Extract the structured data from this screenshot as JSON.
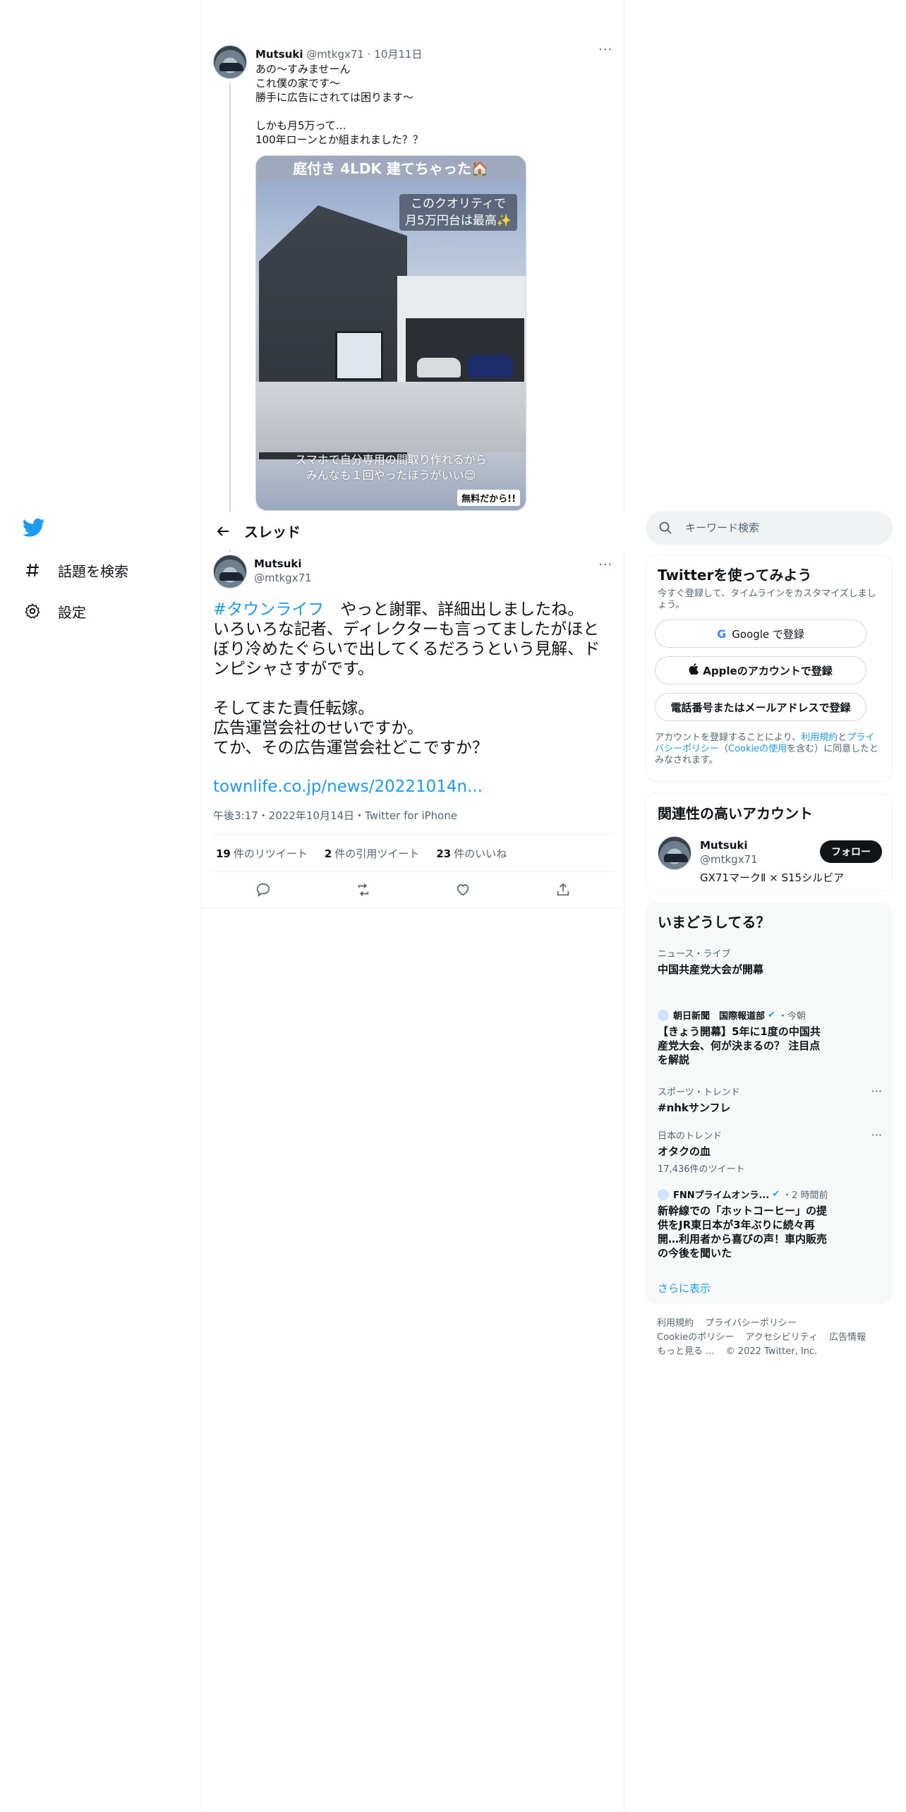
{
  "leftnav": {
    "explore_label": "話題を検索",
    "settings_label": "設定"
  },
  "parent_tweet": {
    "name": "Mutsuki",
    "handle": "@mtkgx71",
    "date": "10月11日",
    "text": "あの〜すみませーん\nこれ僕の家です〜\n勝手に広告にされては困ります〜\n\nしかも月5万って…\n100年ローンとか組まれました？？",
    "media": {
      "banner": "庭付き 4LDK 建てちゃった🏠",
      "caption_top": "このクオリティで\n月5万円台は最高✨",
      "caption_bottom": "スマホで自分専用の間取り作れるから\nみんなも１回やったほうがいい😌",
      "badge": "無料だから!!"
    }
  },
  "thread_header": {
    "title": "スレッド"
  },
  "focus_tweet": {
    "name": "Mutsuki",
    "handle": "@mtkgx71",
    "hashtag": "#タウンライフ",
    "text": "　やっと謝罪、詳細出しましたね。\nいろいろな記者、ディレクターも言ってましたがほとぼり冷めたぐらいで出してくるだろうという見解、ドンピシャさすがです。\n\nそしてまた責任転嫁。\n広告運営会社のせいですか。\nてか、その広告運営会社どこですか？",
    "link": "townlife.co.jp/news/20221014n...",
    "meta": "午後3:17・2022年10月14日・Twitter for iPhone",
    "retweets": {
      "count": "19",
      "label": "件のリツイート"
    },
    "quotes": {
      "count": "2",
      "label": "件の引用ツイート"
    },
    "likes": {
      "count": "23",
      "label": "件のいいね"
    }
  },
  "search": {
    "placeholder": "キーワード検索"
  },
  "signup": {
    "title": "Twitterを使ってみよう",
    "subtitle": "今すぐ登録して、タイムラインをカスタマイズしましょう。",
    "google_label": "Google で登録",
    "apple_label": "Appleのアカウントで登録",
    "phone_label": "電話番号またはメールアドレスで登録",
    "legal_prefix": "アカウントを登録することにより、",
    "legal_link1": "利用規約",
    "legal_and": "と",
    "legal_link2": "プライバシーポリシー",
    "legal_mid": "（",
    "legal_link3": "Cookieの使用",
    "legal_suffix": "を含む）に同意したとみなされます。"
  },
  "related": {
    "title": "関連性の高いアカウント",
    "name": "Mutsuki",
    "handle": "@mtkgx71",
    "bio": "GX71マークⅡ × S15シルビア",
    "follow_label": "フォロー"
  },
  "trends": {
    "title": "いまどうしてる？",
    "items": [
      {
        "context": "ニュース・ライブ",
        "title": "中国共産党大会が開幕"
      },
      {
        "source": "朝日新聞　国際報道部",
        "time": "・今朝",
        "title": "【きょう開幕】5年に1度の中国共産党大会、何が決まるの？ 注目点を解説"
      },
      {
        "context": "スポーツ・トレンド",
        "title": "#nhkサンフレ"
      },
      {
        "context": "日本のトレンド",
        "title": "オタクの血",
        "count": "17,436件のツイート"
      },
      {
        "source": "FNNプライムオンラ...",
        "time": "・2 時間前",
        "title": "新幹線での「ホットコーヒー」の提供をJR東日本が3年ぶりに続々再開…利用者から喜びの声！車内販売の今後を聞いた"
      }
    ],
    "show_more": "さらに表示"
  },
  "footer": {
    "links": [
      "利用規約",
      "プライバシーポリシー",
      "Cookieのポリシー",
      "アクセシビリティ",
      "広告情報",
      "もっと見る ..."
    ],
    "copyright": "© 2022 Twitter, Inc."
  },
  "colors": {
    "accent": "#1d9bf0",
    "text": "#0f1419",
    "muted": "#536471",
    "border": "#eff3f4"
  }
}
